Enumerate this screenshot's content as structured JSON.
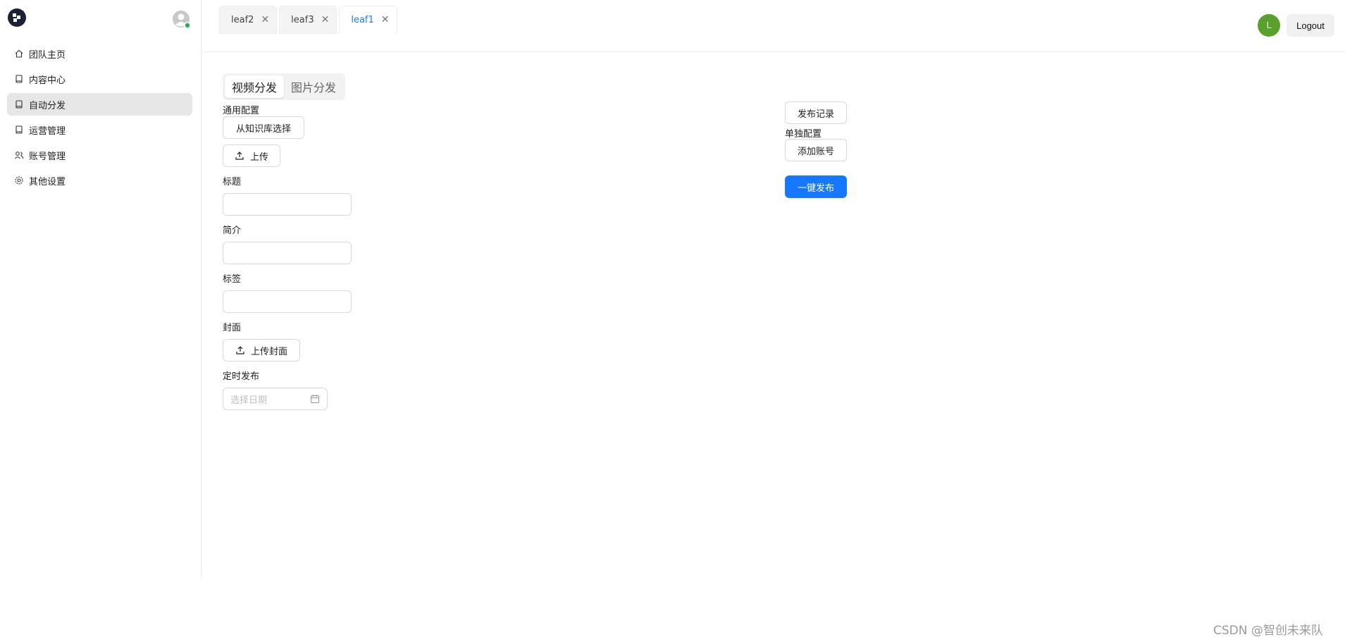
{
  "sidebar": {
    "items": [
      {
        "label": "团队主页",
        "icon": "home-icon",
        "active": false
      },
      {
        "label": "内容中心",
        "icon": "book-icon",
        "active": false
      },
      {
        "label": "自动分发",
        "icon": "book-icon",
        "active": true
      },
      {
        "label": "运营管理",
        "icon": "book-icon",
        "active": false
      },
      {
        "label": "账号管理",
        "icon": "users-icon",
        "active": false
      },
      {
        "label": "其他设置",
        "icon": "gear-icon",
        "active": false
      }
    ]
  },
  "tabs": [
    {
      "label": "leaf2",
      "active": false
    },
    {
      "label": "leaf3",
      "active": false
    },
    {
      "label": "leaf1",
      "active": true
    }
  ],
  "header": {
    "avatar_letter": "L",
    "logout_label": "Logout"
  },
  "segmented": {
    "options": [
      "视频分发",
      "图片分发"
    ],
    "selected": "视频分发"
  },
  "form": {
    "general_config_label": "通用配置",
    "choose_kb_button": "从知识库选择",
    "upload_button": "上传",
    "title_label": "标题",
    "intro_label": "简介",
    "tags_label": "标签",
    "cover_label": "封面",
    "upload_cover_button": "上传封面",
    "schedule_label": "定时发布",
    "date_placeholder": "选择日期"
  },
  "right_panel": {
    "publish_log_button": "发布记录",
    "separate_config_label": "单独配置",
    "add_account_button": "添加账号",
    "one_click_publish_button": "一键发布"
  },
  "colors": {
    "primary": "#1677ff",
    "avatar_bg": "#5aa02c",
    "active_nav_bg": "#e6e6e6",
    "status_dot": "#22b14c"
  },
  "watermark": "CSDN @智创未来队"
}
